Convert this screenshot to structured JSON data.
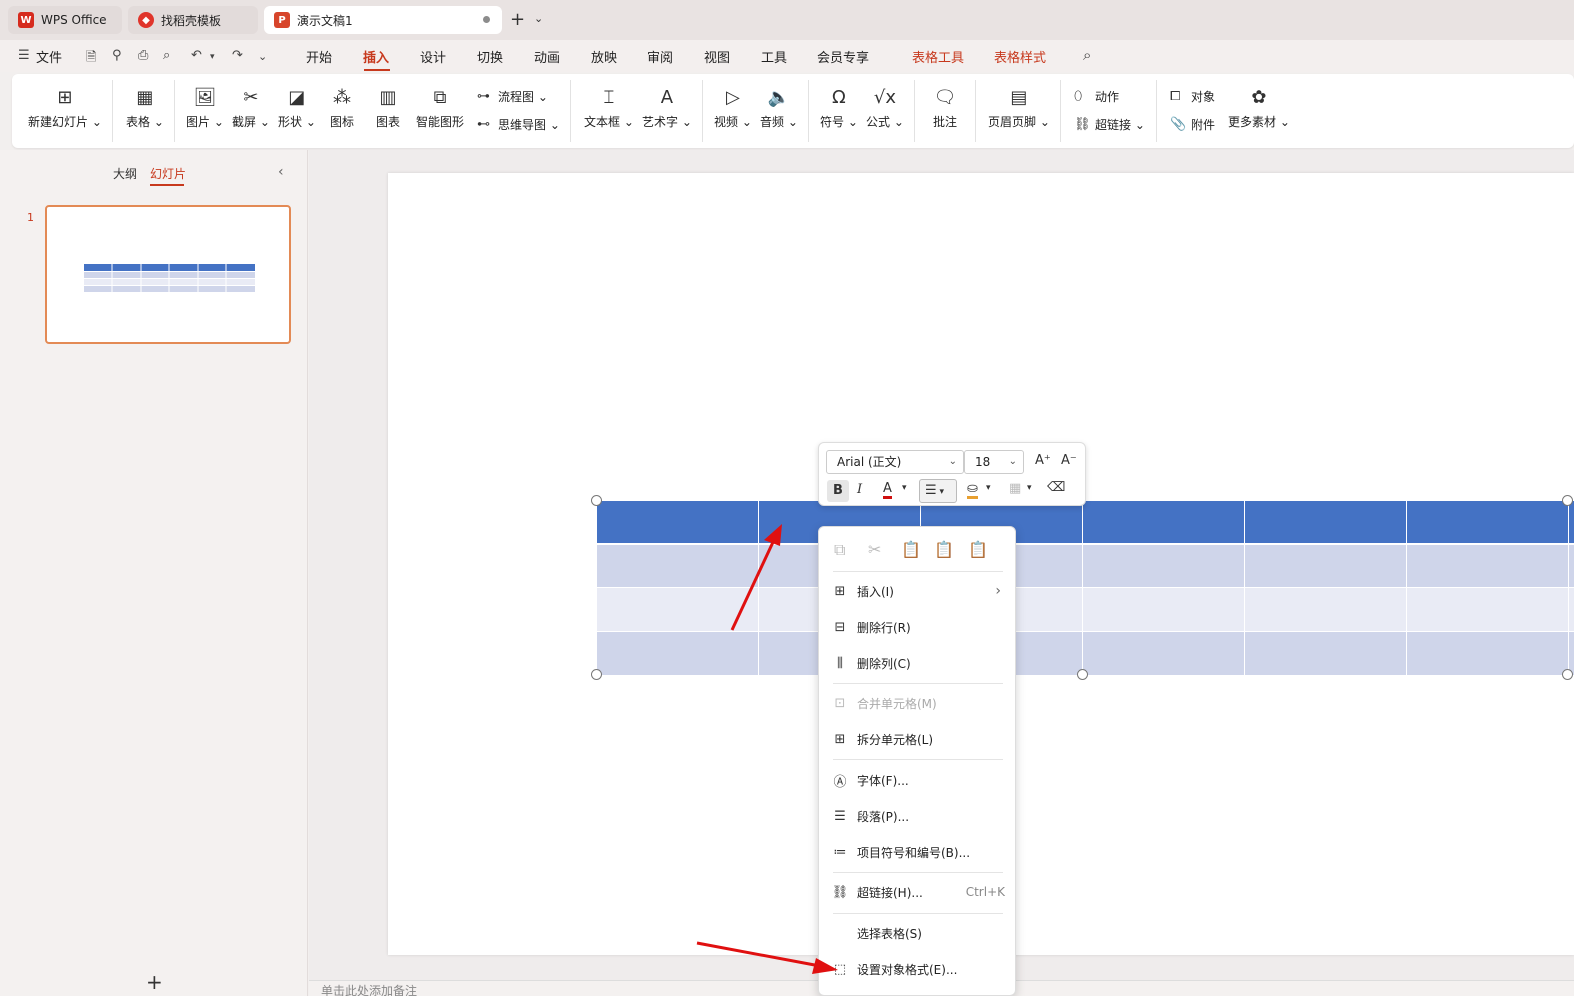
{
  "colors": {
    "accent": "#c7391d",
    "table_header": "#4472c4",
    "table_band_dark": "#cfd5ea",
    "table_band_light": "#e9ebf5",
    "annotation_arrow": "#e01010"
  },
  "tabs": [
    {
      "label": "WPS Office",
      "icon": "wps-logo-icon"
    },
    {
      "label": "找稻壳模板",
      "icon": "docer-icon"
    },
    {
      "label": "演示文稿1",
      "icon": "presentation-icon"
    }
  ],
  "menu": {
    "file": "文件",
    "items": [
      "开始",
      "插入",
      "设计",
      "切换",
      "动画",
      "放映",
      "审阅",
      "视图",
      "工具",
      "会员专享"
    ],
    "active": "插入",
    "context_tabs": [
      "表格工具",
      "表格样式"
    ]
  },
  "ribbon": {
    "new_slide": "新建幻灯片",
    "table": "表格",
    "picture": "图片",
    "screenshot": "截屏",
    "shape": "形状",
    "icon": "图标",
    "chart": "图表",
    "smartart": "智能图形",
    "flowchart": "流程图",
    "mindmap": "思维导图",
    "textbox": "文本框",
    "wordart": "艺术字",
    "video": "视频",
    "audio": "音频",
    "symbol": "符号",
    "formula": "公式",
    "comment": "批注",
    "header_footer": "页眉页脚",
    "action": "动作",
    "hyperlink": "超链接",
    "object": "对象",
    "attachment": "附件",
    "more_materials": "更多素材"
  },
  "left_pane": {
    "tab_outline": "大纲",
    "tab_slides": "幻灯片",
    "slide_number": "1"
  },
  "mini_toolbar": {
    "font_name": "Arial (正文)",
    "font_size": "18",
    "bold": "B",
    "italic": "I",
    "font_color_glyph": "A"
  },
  "context_menu": {
    "items": [
      {
        "label": "插入(I)",
        "has_submenu": true
      },
      {
        "label": "删除行(R)"
      },
      {
        "label": "删除列(C)"
      },
      {
        "label": "合并单元格(M)",
        "disabled": true
      },
      {
        "label": "拆分单元格(L)"
      },
      {
        "label": "字体(F)..."
      },
      {
        "label": "段落(P)..."
      },
      {
        "label": "项目符号和编号(B)..."
      },
      {
        "label": "超链接(H)...",
        "shortcut": "Ctrl+K"
      },
      {
        "label": "选择表格(S)"
      },
      {
        "label": "设置对象格式(E)..."
      }
    ]
  },
  "notes_placeholder": "单击此处添加备注"
}
